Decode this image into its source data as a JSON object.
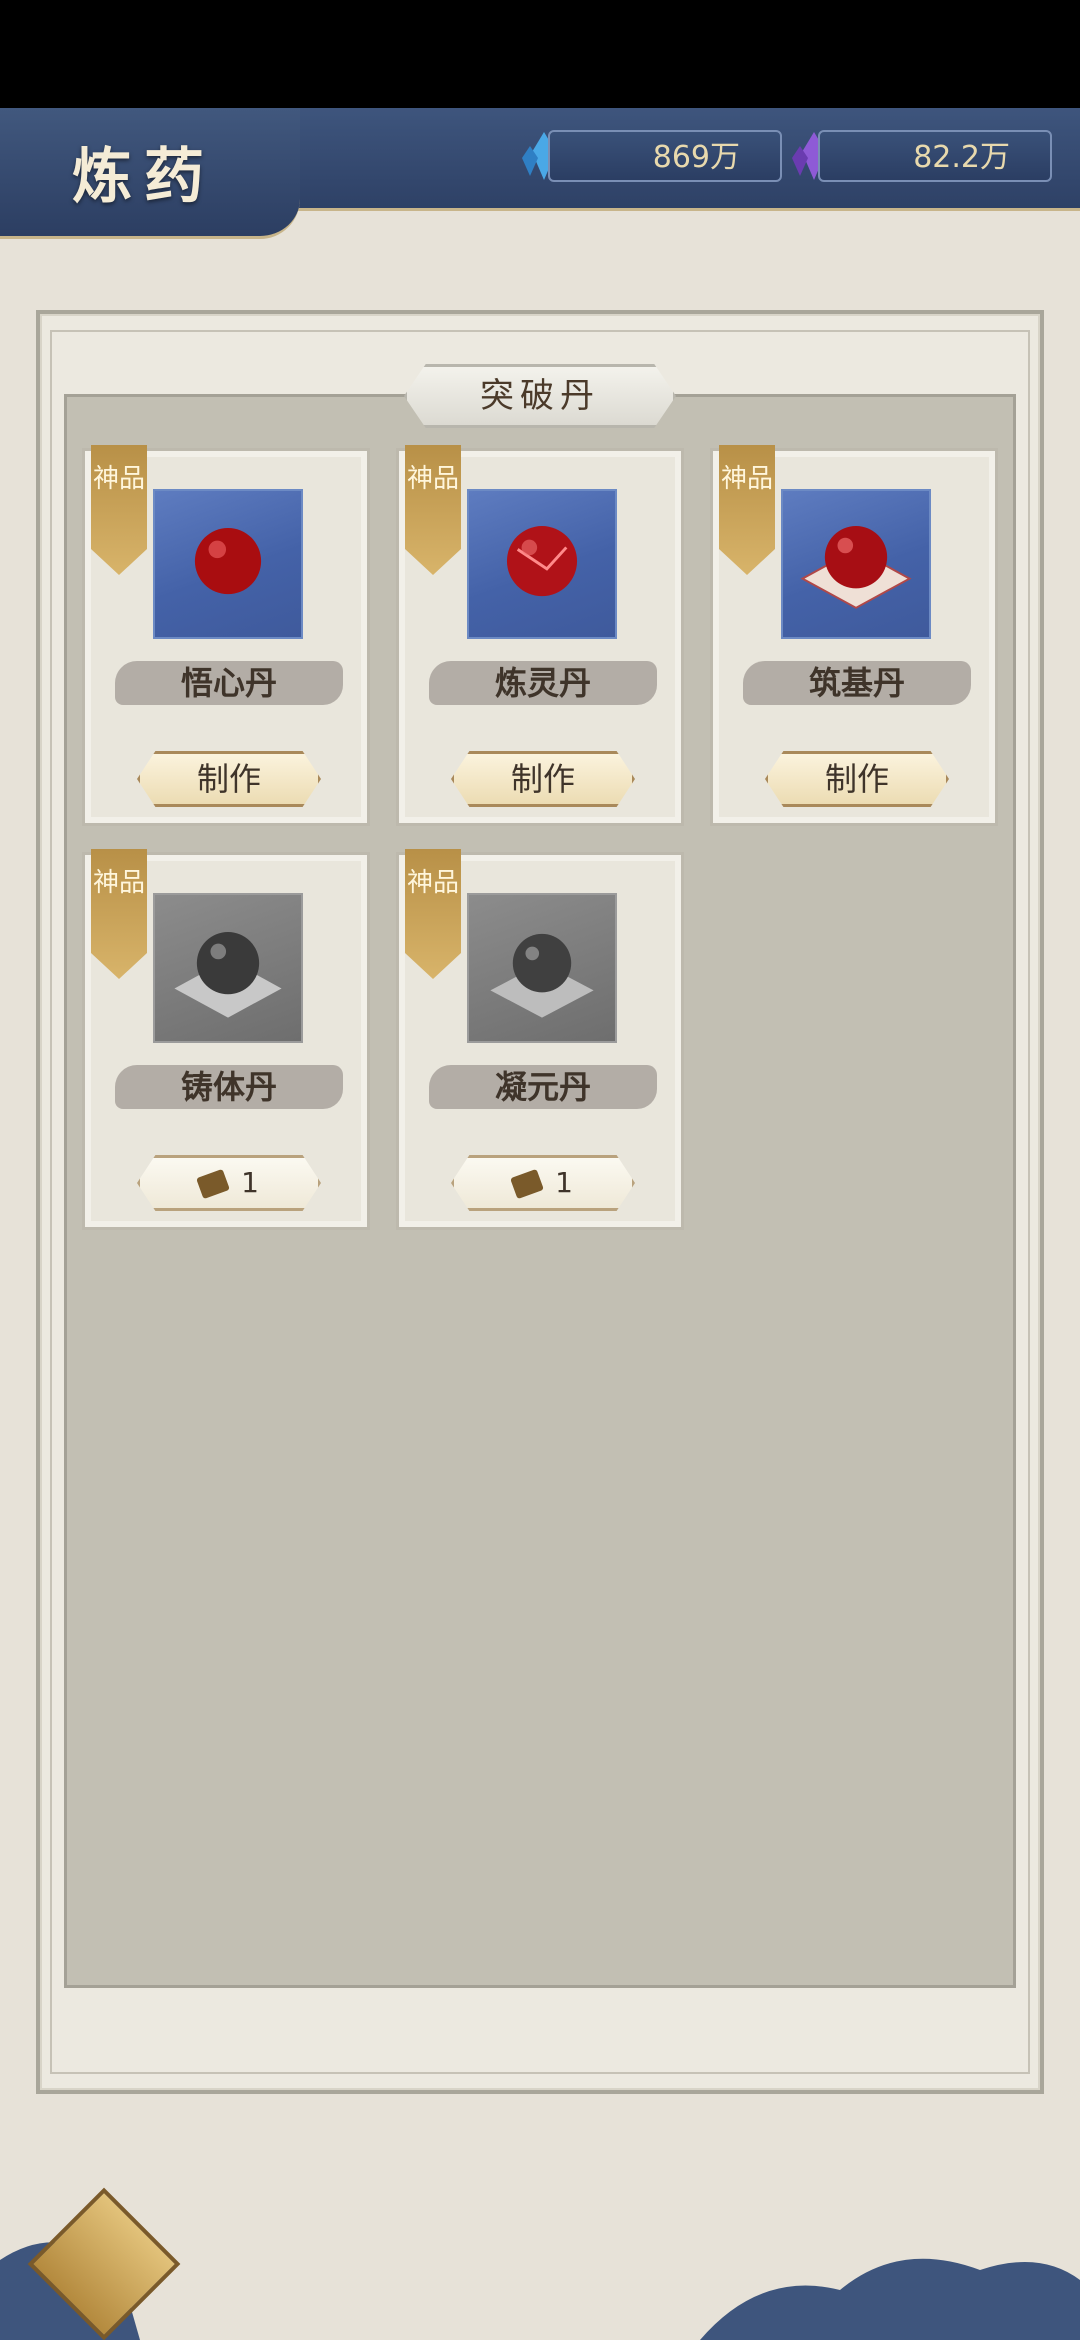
{
  "header": {
    "title": "炼药",
    "currencies": [
      {
        "icon": "blue-crystal-icon",
        "value": "869万"
      },
      {
        "icon": "purple-crystal-icon",
        "value": "82.2万"
      }
    ]
  },
  "section": {
    "title": "突破丹"
  },
  "items": [
    {
      "grade": "神品",
      "name": "悟心丹",
      "action": "制作",
      "image": "red-pill"
    },
    {
      "grade": "神品",
      "name": "炼灵丹",
      "action": "制作",
      "image": "red-pill-cracked"
    },
    {
      "grade": "神品",
      "name": "筑基丹",
      "action": "制作",
      "image": "red-pill-on-cloth"
    },
    {
      "grade": "神品",
      "name": "铸体丹",
      "cost_icon": "ticket-icon",
      "cost": "1",
      "image": "gray-pill-locked"
    },
    {
      "grade": "神品",
      "name": "凝元丹",
      "cost_icon": "ticket-icon",
      "cost": "1",
      "image": "gray-pill-locked"
    }
  ],
  "colors": {
    "header": "#2e4166",
    "accent_gold": "#c8a25a",
    "panel": "#c2bfb3"
  }
}
